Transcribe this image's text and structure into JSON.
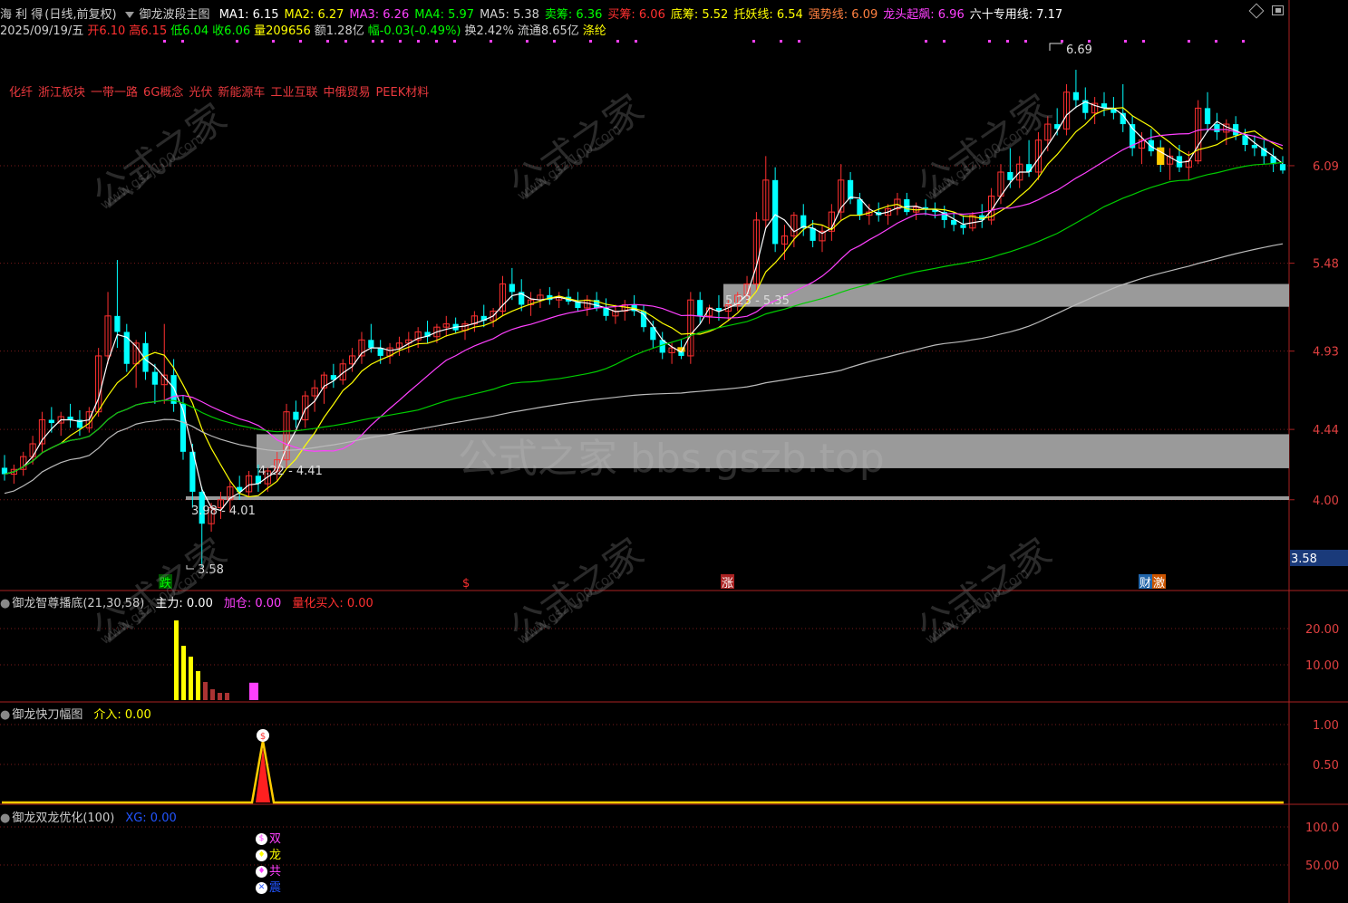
{
  "header": {
    "stock_name": "海 利 得",
    "period": "(日线,前复权)",
    "indicator": "御龙波段主图",
    "items": [
      {
        "label": "MA1:",
        "value": "6.15",
        "color": "#ffffff"
      },
      {
        "label": "MA2:",
        "value": "6.27",
        "color": "#ffff00"
      },
      {
        "label": "MA3:",
        "value": "6.26",
        "color": "#ff40ff"
      },
      {
        "label": "MA4:",
        "value": "5.97",
        "color": "#00ff00"
      },
      {
        "label": "MA5:",
        "value": "5.38",
        "color": "#cfcfcf"
      },
      {
        "label": "卖筹:",
        "value": "6.36",
        "color": "#00ff00"
      },
      {
        "label": "买筹:",
        "value": "6.06",
        "color": "#ff3030"
      },
      {
        "label": "底筹:",
        "value": "5.52",
        "color": "#ffff00"
      },
      {
        "label": "托妖线:",
        "value": "6.54",
        "color": "#ffff00"
      },
      {
        "label": "强势线:",
        "value": "6.09",
        "color": "#ff8040"
      },
      {
        "label": "龙头起飙:",
        "value": "6.96",
        "color": "#ff40ff"
      },
      {
        "label": "六十专用线:",
        "value": "7.17",
        "color": "#ffffff"
      }
    ],
    "line2": [
      {
        "text": "2025/09/19/五",
        "color": "#cfcfcf"
      },
      {
        "text": "开6.10",
        "color": "#ff3030"
      },
      {
        "text": "高6.15",
        "color": "#ff3030"
      },
      {
        "text": "低6.04",
        "color": "#00ff00"
      },
      {
        "text": "收6.06",
        "color": "#00ff00"
      },
      {
        "text": "量209656",
        "color": "#ffff00"
      },
      {
        "text": "额1.28亿",
        "color": "#cfcfcf"
      },
      {
        "text": "幅-0.03(-0.49%)",
        "color": "#00ff00"
      },
      {
        "text": "换2.42%",
        "color": "#cfcfcf"
      },
      {
        "text": "流通8.65亿",
        "color": "#cfcfcf"
      },
      {
        "text": "涤纶",
        "color": "#ffff00"
      }
    ]
  },
  "concepts": [
    "化纤",
    "浙江板块",
    "一带一路",
    "6G概念",
    "光伏",
    "新能源车",
    "工业互联",
    "中俄贸易",
    "PEEK材料"
  ],
  "price_axis": [
    "6.09",
    "5.48",
    "4.93",
    "4.44",
    "4.00"
  ],
  "current_price_label": "3.58",
  "price_labels": {
    "high": "6.69",
    "low": "3.58",
    "zone_top": "5.23 - 5.35",
    "zone_mid": "4.22 - 4.41",
    "zone_low": "3.98 - 4.01"
  },
  "markers": [
    {
      "text": "跌",
      "color": "#00ff00",
      "bg": "#005500"
    },
    {
      "text": "$",
      "color": "#ff3030",
      "bg": ""
    },
    {
      "text": "涨",
      "color": "#ffffff",
      "bg": "#aa2222"
    },
    {
      "text": "财",
      "color": "#ffffff",
      "bg": "#2266aa"
    },
    {
      "text": "激",
      "color": "#ffffff",
      "bg": "#cc5500"
    }
  ],
  "watermark": {
    "site": "公式之家",
    "url": "www.gszj100.com",
    "center": "公式之家 bbs.gszb.top"
  },
  "panel1": {
    "title": "御龙智尊播底(21,30,58)",
    "items": [
      {
        "label": "主力:",
        "value": "0.00",
        "color": "#ffffff"
      },
      {
        "label": "加仓:",
        "value": "0.00",
        "color": "#ff40ff"
      },
      {
        "label": "量化买入:",
        "value": "0.00",
        "color": "#ff3030"
      }
    ],
    "axis": [
      "20.00",
      "10.00"
    ]
  },
  "panel2": {
    "title": "御龙快刀幅图",
    "items": [
      {
        "label": "介入:",
        "value": "0.00",
        "color": "#ffff00"
      }
    ],
    "axis": [
      "1.00",
      "0.50"
    ]
  },
  "panel3": {
    "title": "御龙双龙优化(100)",
    "items": [
      {
        "label": "XG:",
        "value": "0.00",
        "color": "#2255ff"
      }
    ],
    "axis": [
      "100.0",
      "50.00"
    ],
    "signals": [
      {
        "icon": "$",
        "text": "双",
        "color": "#ff40ff"
      },
      {
        "icon": "♦",
        "text": "龙",
        "color": "#ffff00"
      },
      {
        "icon": "♦",
        "text": "共",
        "color": "#ff40ff"
      },
      {
        "icon": "✕",
        "text": "震",
        "color": "#2255ff"
      }
    ]
  },
  "chart_data": {
    "type": "candlestick",
    "title": "御龙波段主图",
    "ylim": [
      3.5,
      6.9
    ],
    "colors": {
      "up": "#ff3030",
      "down": "#00ffff",
      "ma_white": "#ffffff",
      "ma_yellow": "#ffff00",
      "ma_magenta": "#ff40ff",
      "ma_green": "#00cc00",
      "ma_gray": "#bbbbbb"
    },
    "candles": [
      [
        4.2,
        4.28,
        4.12,
        4.16
      ],
      [
        4.16,
        4.22,
        4.1,
        4.19
      ],
      [
        4.19,
        4.3,
        4.15,
        4.27
      ],
      [
        4.27,
        4.4,
        4.22,
        4.35
      ],
      [
        4.35,
        4.55,
        4.3,
        4.5
      ],
      [
        4.5,
        4.58,
        4.42,
        4.48
      ],
      [
        4.48,
        4.55,
        4.4,
        4.52
      ],
      [
        4.52,
        4.6,
        4.45,
        4.5
      ],
      [
        4.5,
        4.56,
        4.4,
        4.45
      ],
      [
        4.45,
        4.58,
        4.42,
        4.55
      ],
      [
        4.55,
        4.95,
        4.52,
        4.9
      ],
      [
        4.9,
        5.3,
        4.85,
        5.15
      ],
      [
        5.15,
        5.5,
        4.95,
        5.05
      ],
      [
        5.05,
        5.1,
        4.8,
        4.85
      ],
      [
        4.85,
        5.0,
        4.7,
        4.98
      ],
      [
        4.98,
        5.05,
        4.75,
        4.8
      ],
      [
        4.8,
        4.85,
        4.6,
        4.72
      ],
      [
        4.72,
        5.1,
        4.6,
        4.78
      ],
      [
        4.78,
        4.88,
        4.55,
        4.6
      ],
      [
        4.6,
        4.65,
        4.25,
        4.3
      ],
      [
        4.3,
        4.35,
        3.95,
        4.05
      ],
      [
        4.05,
        4.08,
        3.58,
        3.85
      ],
      [
        3.85,
        3.98,
        3.8,
        3.95
      ],
      [
        3.95,
        4.05,
        3.88,
        4.0
      ],
      [
        4.0,
        4.12,
        3.92,
        4.08
      ],
      [
        4.08,
        4.15,
        4.0,
        4.05
      ],
      [
        4.05,
        4.18,
        4.02,
        4.15
      ],
      [
        4.15,
        4.22,
        4.05,
        4.1
      ],
      [
        4.1,
        4.2,
        4.05,
        4.18
      ],
      [
        4.18,
        4.3,
        4.12,
        4.25
      ],
      [
        4.25,
        4.6,
        4.2,
        4.55
      ],
      [
        4.55,
        4.62,
        4.45,
        4.5
      ],
      [
        4.5,
        4.68,
        4.45,
        4.65
      ],
      [
        4.65,
        4.75,
        4.55,
        4.7
      ],
      [
        4.7,
        4.8,
        4.6,
        4.78
      ],
      [
        4.78,
        4.85,
        4.7,
        4.75
      ],
      [
        4.75,
        4.88,
        4.72,
        4.85
      ],
      [
        4.85,
        4.95,
        4.8,
        4.9
      ],
      [
        4.9,
        5.05,
        4.85,
        5.0
      ],
      [
        5.0,
        5.1,
        4.92,
        4.95
      ],
      [
        4.95,
        5.0,
        4.85,
        4.9
      ],
      [
        4.9,
        4.98,
        4.85,
        4.95
      ],
      [
        4.95,
        5.02,
        4.9,
        4.98
      ],
      [
        4.98,
        5.05,
        4.92,
        5.0
      ],
      [
        5.0,
        5.08,
        4.95,
        5.05
      ],
      [
        5.05,
        5.12,
        4.98,
        5.02
      ],
      [
        5.02,
        5.1,
        4.98,
        5.08
      ],
      [
        5.08,
        5.15,
        5.02,
        5.1
      ],
      [
        5.1,
        5.14,
        5.04,
        5.06
      ],
      [
        5.06,
        5.12,
        5.0,
        5.1
      ],
      [
        5.1,
        5.18,
        5.05,
        5.15
      ],
      [
        5.15,
        5.22,
        5.08,
        5.12
      ],
      [
        5.12,
        5.2,
        5.08,
        5.18
      ],
      [
        5.18,
        5.4,
        5.15,
        5.35
      ],
      [
        5.35,
        5.45,
        5.25,
        5.3
      ],
      [
        5.3,
        5.38,
        5.18,
        5.22
      ],
      [
        5.22,
        5.3,
        5.15,
        5.25
      ],
      [
        5.25,
        5.32,
        5.2,
        5.28
      ],
      [
        5.28,
        5.33,
        5.22,
        5.25
      ],
      [
        5.25,
        5.3,
        5.2,
        5.27
      ],
      [
        5.27,
        5.32,
        5.22,
        5.24
      ],
      [
        5.24,
        5.3,
        5.18,
        5.2
      ],
      [
        5.2,
        5.28,
        5.15,
        5.25
      ],
      [
        5.25,
        5.3,
        5.18,
        5.2
      ],
      [
        5.2,
        5.26,
        5.12,
        5.15
      ],
      [
        5.15,
        5.22,
        5.1,
        5.18
      ],
      [
        5.18,
        5.25,
        5.12,
        5.22
      ],
      [
        5.22,
        5.28,
        5.15,
        5.18
      ],
      [
        5.18,
        5.22,
        5.05,
        5.08
      ],
      [
        5.08,
        5.12,
        4.95,
        5.0
      ],
      [
        5.0,
        5.05,
        4.88,
        4.92
      ],
      [
        4.92,
        4.98,
        4.85,
        4.95
      ],
      [
        4.95,
        5.0,
        4.88,
        4.9
      ],
      [
        4.9,
        5.3,
        4.85,
        5.25
      ],
      [
        5.25,
        5.3,
        5.1,
        5.15
      ],
      [
        5.15,
        5.22,
        5.1,
        5.2
      ],
      [
        5.2,
        5.28,
        5.12,
        5.18
      ],
      [
        5.18,
        5.25,
        5.12,
        5.22
      ],
      [
        5.22,
        5.3,
        5.18,
        5.28
      ],
      [
        5.28,
        5.4,
        5.22,
        5.35
      ],
      [
        5.35,
        5.8,
        5.3,
        5.75
      ],
      [
        5.75,
        6.15,
        5.7,
        6.0
      ],
      [
        6.0,
        6.08,
        5.55,
        5.6
      ],
      [
        5.6,
        5.72,
        5.5,
        5.65
      ],
      [
        5.65,
        5.8,
        5.58,
        5.78
      ],
      [
        5.78,
        5.85,
        5.65,
        5.7
      ],
      [
        5.7,
        5.75,
        5.58,
        5.62
      ],
      [
        5.62,
        5.72,
        5.55,
        5.68
      ],
      [
        5.68,
        5.85,
        5.62,
        5.8
      ],
      [
        5.8,
        6.1,
        5.75,
        6.0
      ],
      [
        6.0,
        6.05,
        5.85,
        5.88
      ],
      [
        5.88,
        5.92,
        5.75,
        5.78
      ],
      [
        5.78,
        5.85,
        5.72,
        5.8
      ],
      [
        5.8,
        5.86,
        5.74,
        5.78
      ],
      [
        5.78,
        5.85,
        5.72,
        5.82
      ],
      [
        5.82,
        5.92,
        5.78,
        5.88
      ],
      [
        5.88,
        5.92,
        5.78,
        5.8
      ],
      [
        5.8,
        5.86,
        5.75,
        5.83
      ],
      [
        5.83,
        5.88,
        5.78,
        5.82
      ],
      [
        5.82,
        5.86,
        5.76,
        5.8
      ],
      [
        5.8,
        5.84,
        5.7,
        5.75
      ],
      [
        5.75,
        5.8,
        5.68,
        5.72
      ],
      [
        5.72,
        5.78,
        5.66,
        5.7
      ],
      [
        5.7,
        5.8,
        5.68,
        5.78
      ],
      [
        5.78,
        5.85,
        5.7,
        5.75
      ],
      [
        5.75,
        5.95,
        5.72,
        5.9
      ],
      [
        5.9,
        6.1,
        5.85,
        6.05
      ],
      [
        6.05,
        6.2,
        5.95,
        6.0
      ],
      [
        6.0,
        6.15,
        5.95,
        6.1
      ],
      [
        6.1,
        6.25,
        6.02,
        6.05
      ],
      [
        6.05,
        6.3,
        6.0,
        6.25
      ],
      [
        6.25,
        6.4,
        6.18,
        6.35
      ],
      [
        6.35,
        6.45,
        6.28,
        6.32
      ],
      [
        6.32,
        6.6,
        6.28,
        6.55
      ],
      [
        6.55,
        6.69,
        6.45,
        6.5
      ],
      [
        6.5,
        6.58,
        6.38,
        6.42
      ],
      [
        6.42,
        6.52,
        6.35,
        6.48
      ],
      [
        6.48,
        6.55,
        6.4,
        6.45
      ],
      [
        6.45,
        6.52,
        6.38,
        6.42
      ],
      [
        6.42,
        6.6,
        6.3,
        6.35
      ],
      [
        6.35,
        6.4,
        6.15,
        6.2
      ],
      [
        6.2,
        6.3,
        6.1,
        6.25
      ],
      [
        6.25,
        6.32,
        6.15,
        6.18
      ],
      [
        6.18,
        6.25,
        6.05,
        6.1
      ],
      [
        6.1,
        6.2,
        6.0,
        6.15
      ],
      [
        6.15,
        6.22,
        6.05,
        6.08
      ],
      [
        6.08,
        6.18,
        6.0,
        6.12
      ],
      [
        6.12,
        6.5,
        6.1,
        6.45
      ],
      [
        6.45,
        6.55,
        6.3,
        6.35
      ],
      [
        6.35,
        6.42,
        6.25,
        6.3
      ],
      [
        6.3,
        6.38,
        6.22,
        6.35
      ],
      [
        6.35,
        6.4,
        6.25,
        6.28
      ],
      [
        6.28,
        6.32,
        6.18,
        6.22
      ],
      [
        6.22,
        6.28,
        6.15,
        6.2
      ],
      [
        6.2,
        6.25,
        6.1,
        6.15
      ],
      [
        6.15,
        6.2,
        6.05,
        6.1
      ],
      [
        6.1,
        6.15,
        6.04,
        6.06
      ]
    ],
    "volume_bars": [
      22,
      15,
      12,
      8,
      5,
      3,
      2,
      2
    ],
    "panel1_magenta_bar": 8
  }
}
